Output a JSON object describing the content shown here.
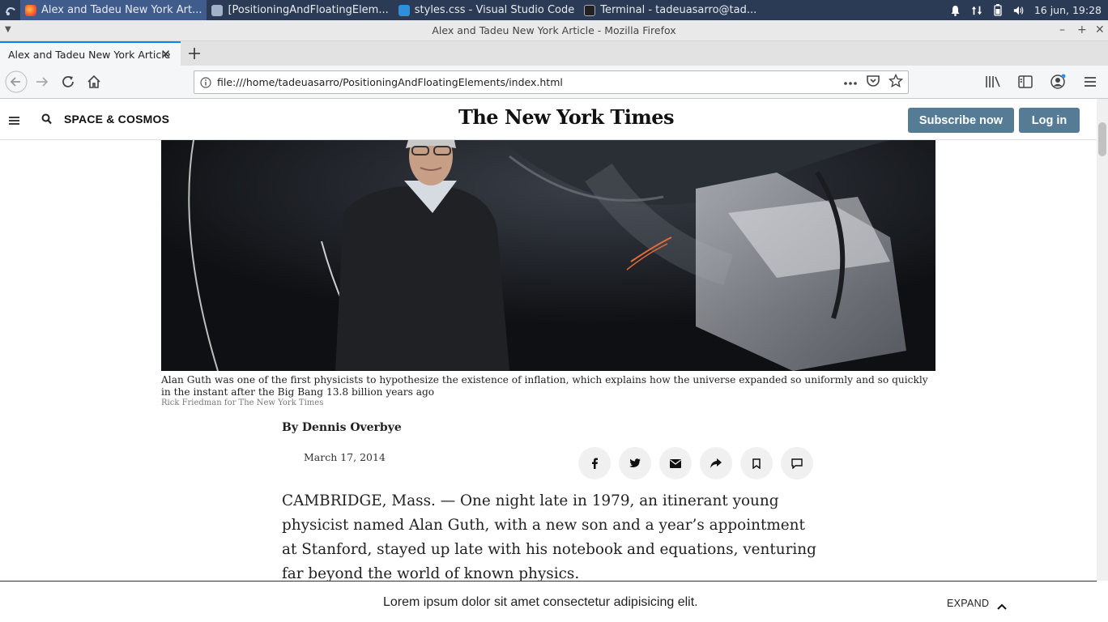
{
  "taskbar": {
    "tasks": [
      {
        "label": "Alex and Tadeu New York Art...",
        "active": true
      },
      {
        "label": "[PositioningAndFloatingElem...",
        "active": false
      },
      {
        "label": "styles.css - Visual Studio Code",
        "active": false
      },
      {
        "label": "Terminal - tadeuasarro@tad...",
        "active": false
      }
    ],
    "clock": "16 jun, 19:28"
  },
  "window": {
    "title": "Alex and Tadeu New York Article - Mozilla Firefox"
  },
  "browser": {
    "tab_label": "Alex and Tadeu New York Article",
    "url": "file:///home/tadeuasarro/PositioningAndFloatingElements/index.html"
  },
  "header": {
    "section": "SPACE & COSMOS",
    "logo": "The New York Times",
    "subscribe": "Subscribe now",
    "login": "Log in"
  },
  "article": {
    "caption": "Alan Guth was one of the first physicists to hypothesize the existence of inflation, which explains how the universe expanded so uniformly and so quickly in the instant after the Big Bang 13.8 billion years ago",
    "credit": "Rick Friedman for The New York Times",
    "byline": "By Dennis Overbye",
    "date": "March 17, 2014",
    "body": "CAMBRIDGE, Mass. — One night late in 1979, an itinerant young physicist named Alan Guth, with a new son and a year’s appointment at Stanford, stayed up late with his notebook and equations, venturing far beyond the world of known physics."
  },
  "share": [
    "facebook-icon",
    "twitter-icon",
    "email-icon",
    "share-icon",
    "bookmark-icon",
    "comment-icon"
  ],
  "footer": {
    "text": "Lorem ipsum dolor sit amet consectetur adipisicing elit.",
    "expand": "EXPAND"
  }
}
